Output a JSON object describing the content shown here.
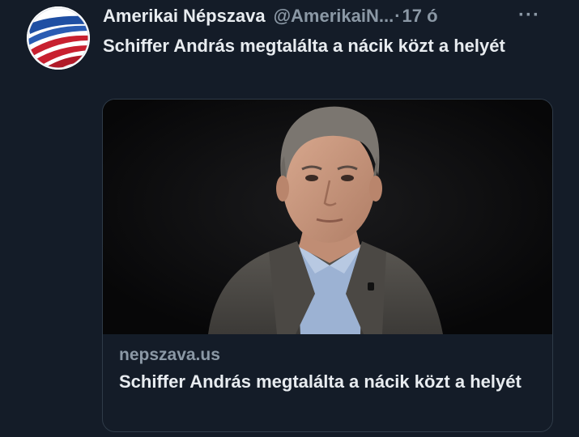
{
  "tweet": {
    "author": {
      "display_name": "Amerikai Népszava",
      "handle": "@AmerikaiN...",
      "separator": "·",
      "time": "17 ó",
      "avatar_icon": "flag-stripes-logo-icon"
    },
    "more_icon": "more-horizontal-icon",
    "more_label": "···",
    "text": "Schiffer András megtalálta a nácik közt a helyét",
    "card": {
      "image_icon": "man-portrait-photo",
      "domain": "nepszava.us",
      "title": "Schiffer András megtalálta a nácik közt a helyét"
    }
  },
  "colors": {
    "background": "#141c28",
    "primary_text": "#e8ecf0",
    "secondary_text": "#8b98a5",
    "card_border": "#2f3b48",
    "logo_blue": "#1f4fa3",
    "logo_red": "#c8202f"
  }
}
